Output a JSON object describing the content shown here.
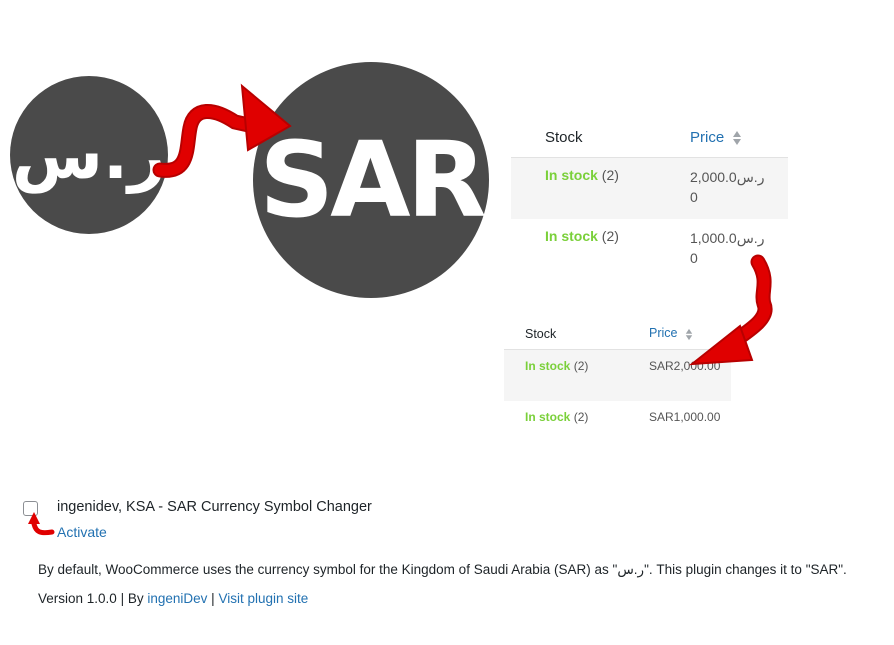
{
  "logos": {
    "old_symbol": "ر.س",
    "new_symbol": "SAR"
  },
  "table_before": {
    "headers": {
      "stock": "Stock",
      "price": "Price"
    },
    "rows": [
      {
        "stock_status": "In stock",
        "stock_count": "(2)",
        "price_line1": "ر.س2,000.0",
        "price_line2": "0"
      },
      {
        "stock_status": "In stock",
        "stock_count": "(2)",
        "price_line1": "ر.س1,000.0",
        "price_line2": "0"
      }
    ]
  },
  "table_after": {
    "headers": {
      "stock": "Stock",
      "price": "Price"
    },
    "rows": [
      {
        "stock_status": "In stock",
        "stock_count": "(2)",
        "price": "SAR2,000.00"
      },
      {
        "stock_status": "In stock",
        "stock_count": "(2)",
        "price": "SAR1,000.00"
      }
    ]
  },
  "plugin": {
    "name": "ingenidev, KSA - SAR Currency Symbol Changer",
    "action": "Activate",
    "description": "By default, WooCommerce uses the currency symbol for the Kingdom of Saudi Arabia (SAR) as \"ر.س\". This plugin changes it to \"SAR\".",
    "version": "Version 1.0.0",
    "by_prefix": "| By",
    "author": "ingeniDev",
    "separator": "|",
    "site_link": "Visit plugin site"
  },
  "colors": {
    "circle": "#4a4a4a",
    "arrow": "#e00000",
    "in_stock": "#7ad03a",
    "link": "#2271b1",
    "stripe": "#f5f5f5"
  },
  "icons": [
    "curved-arrow-icon",
    "sort-icon",
    "checkbox"
  ]
}
